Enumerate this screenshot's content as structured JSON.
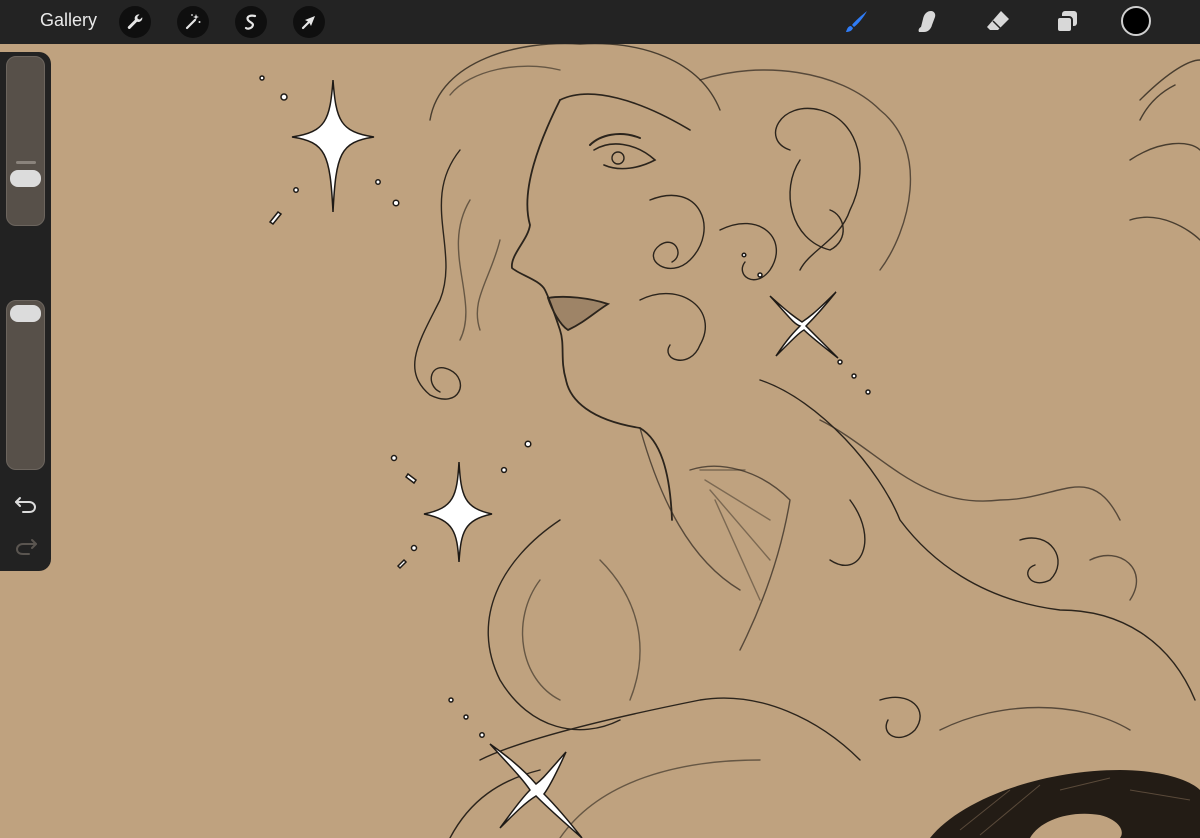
{
  "app": {
    "gallery_label": "Gallery"
  },
  "toolbar": {
    "left_tools": [
      {
        "name": "actions",
        "icon": "wrench-icon"
      },
      {
        "name": "adjustments",
        "icon": "magic-wand-icon"
      },
      {
        "name": "selection",
        "icon": "selection-s-icon"
      },
      {
        "name": "transform",
        "icon": "arrow-cursor-icon"
      }
    ],
    "right_tools": [
      {
        "name": "brush",
        "icon": "brush-icon",
        "active": true
      },
      {
        "name": "smudge",
        "icon": "smudge-finger-icon",
        "active": false
      },
      {
        "name": "eraser",
        "icon": "eraser-icon",
        "active": false
      },
      {
        "name": "layers",
        "icon": "layers-icon",
        "active": false
      }
    ],
    "current_color": "#000000"
  },
  "sidebar": {
    "brush_size_level": 0.42,
    "opacity_level": 0.97,
    "modify_button_icon": "square-icon",
    "undo_icon": "undo-icon",
    "redo_icon": "redo-icon",
    "redo_enabled": false
  },
  "colors": {
    "canvas": "#bfa27f",
    "toolbar": "#232323",
    "active_accent": "#2f7cf6",
    "line": "#2b241c"
  }
}
